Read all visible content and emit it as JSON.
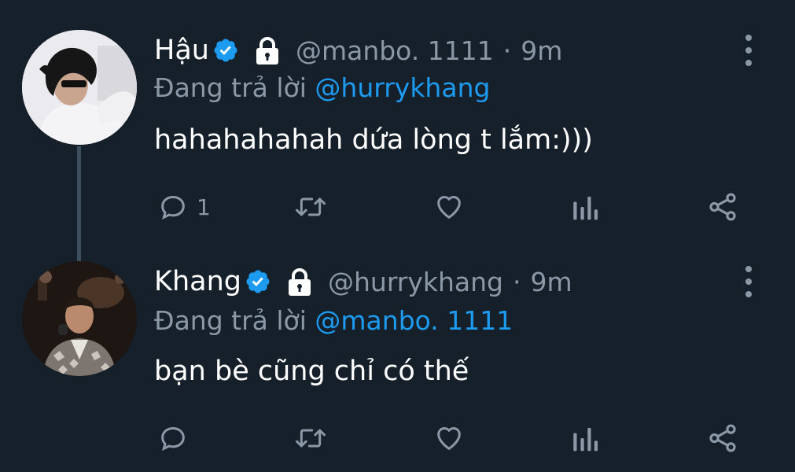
{
  "tweets": [
    {
      "name": "Hậu",
      "handle": "@manbo. 1111",
      "separator": "·",
      "time": "9m",
      "reply_prefix": "Đang trả lời",
      "reply_to": "@hurrykhang",
      "text": "hahahahahah dứa lòng t lắm:)))",
      "reply_count": "1"
    },
    {
      "name": "Khang",
      "handle": "@hurrykhang",
      "separator": "·",
      "time": "9m",
      "reply_prefix": "Đang trả lời",
      "reply_to": "@manbo. 1111",
      "text": "bạn bè cũng chỉ có thế",
      "reply_count": ""
    }
  ],
  "colors": {
    "background": "#15202b",
    "secondary_text": "#8b98a5",
    "accent": "#1d9bf0",
    "thread_line": "#3d4f5e"
  },
  "icons": {
    "verified": "verified-badge-icon",
    "lock": "lock-icon",
    "more": "more-vertical-icon",
    "reply": "reply-icon",
    "retweet": "retweet-icon",
    "like": "heart-icon",
    "views": "views-icon",
    "share": "share-icon"
  }
}
